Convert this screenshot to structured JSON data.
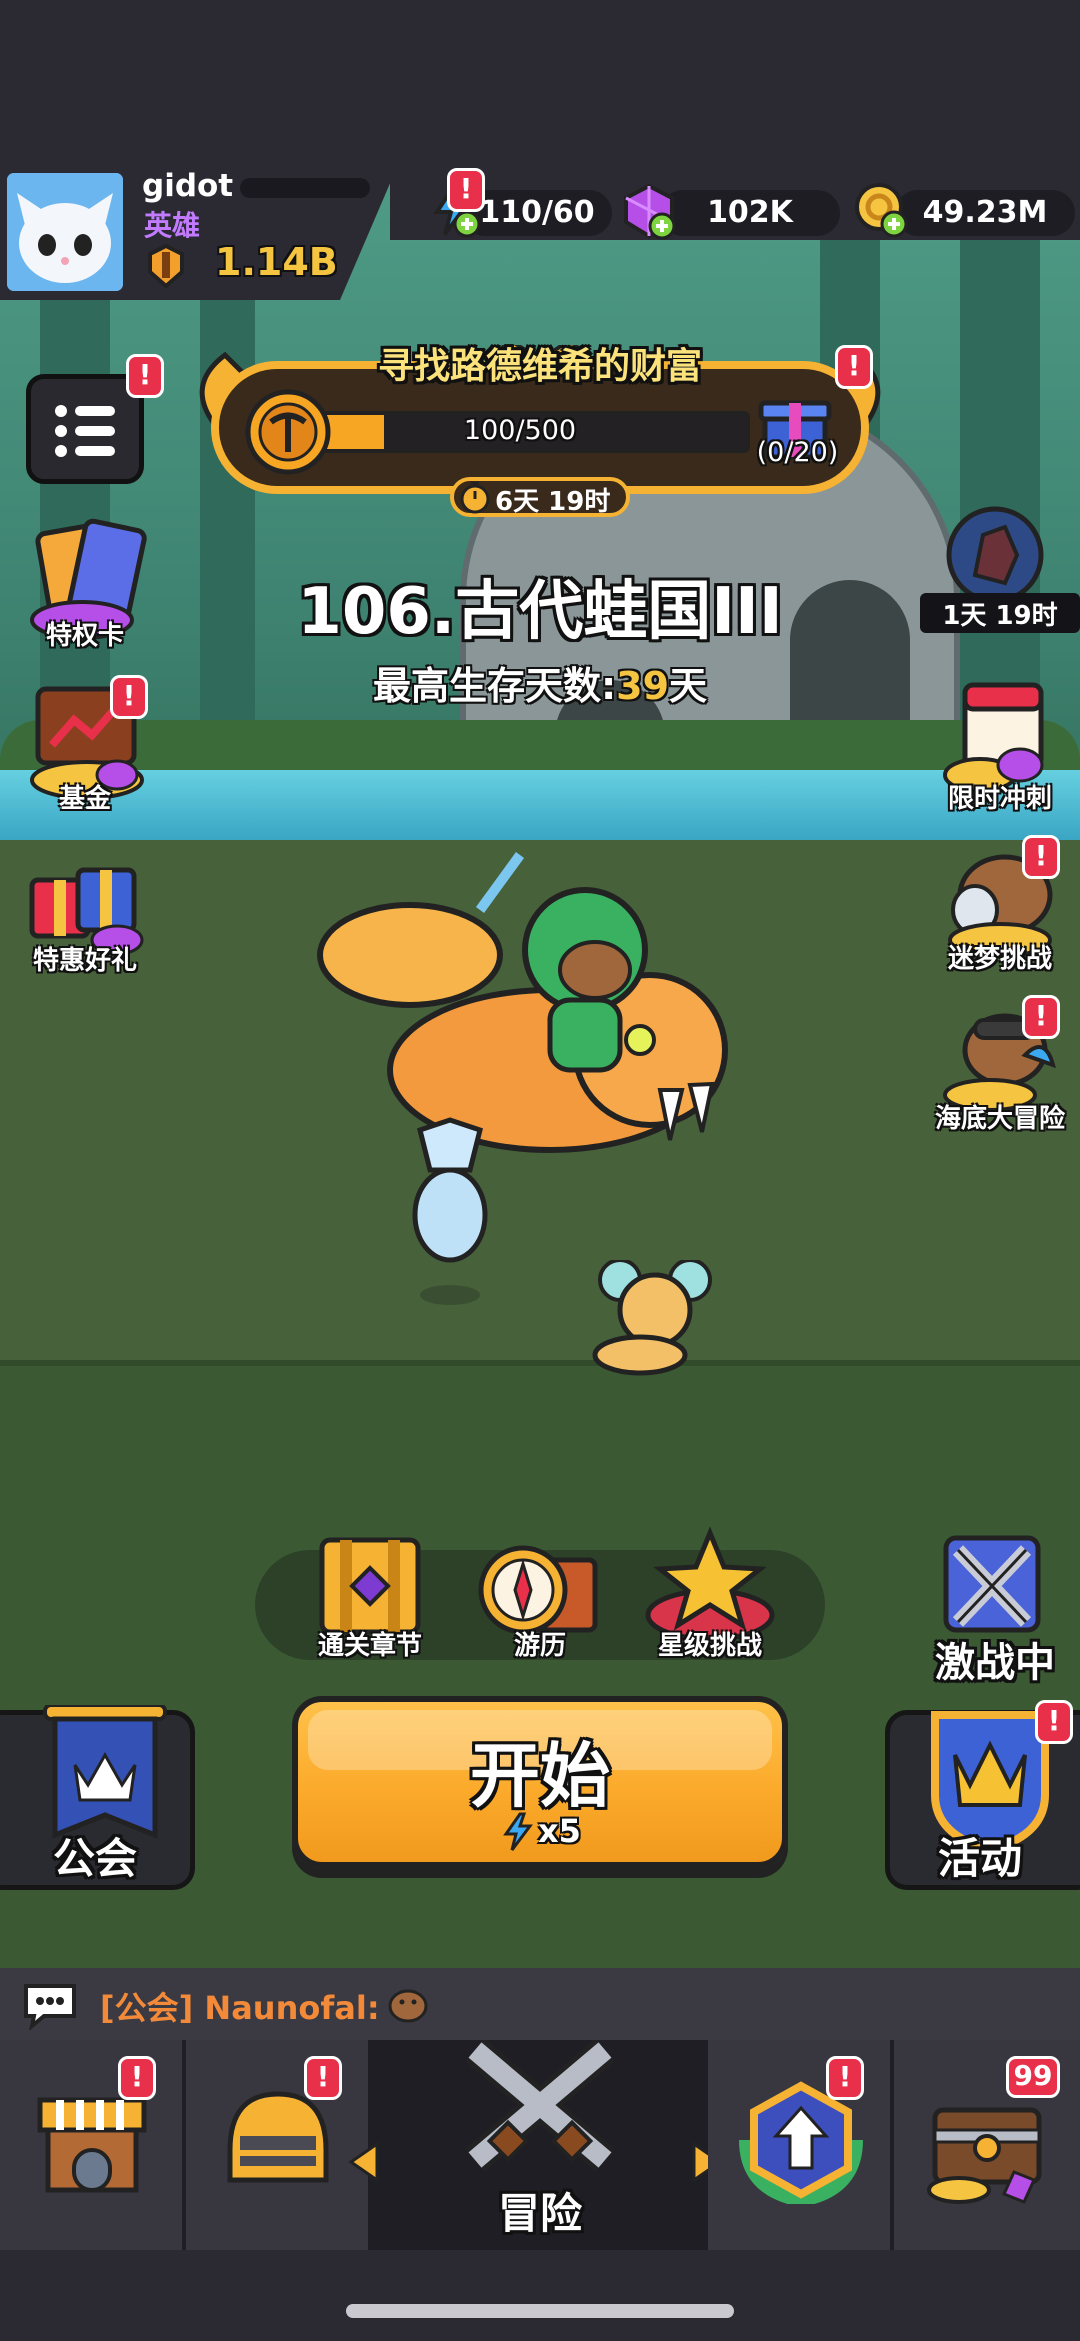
{
  "player": {
    "name": "gidot",
    "rank": "英雄",
    "power": "1.14B"
  },
  "resources": {
    "energy": "110/60",
    "gems": "102K",
    "gold": "49.23M"
  },
  "event": {
    "title": "寻找路德维希的财富",
    "progress_text": "100/500",
    "progress_fraction": 0.2,
    "chest_count": "(0/20)",
    "timer": "6天 19时"
  },
  "stage": {
    "title": "106.古代蛙国III",
    "best_label": "最高生存天数:",
    "best_value": "39",
    "best_unit": "天"
  },
  "left_menu": [
    {
      "label": "特权卡"
    },
    {
      "label": "基金"
    },
    {
      "label": "特惠好礼"
    }
  ],
  "right_menu": [
    {
      "label": "1天 19时"
    },
    {
      "label": "限时冲刺"
    },
    {
      "label": "迷梦挑战"
    },
    {
      "label": "海底大冒险"
    }
  ],
  "actions": [
    {
      "label": "通关章节"
    },
    {
      "label": "游历"
    },
    {
      "label": "星级挑战"
    }
  ],
  "battle_status": "激战中",
  "start": {
    "label": "开始",
    "cost": "x5"
  },
  "guild_label": "公会",
  "events_label": "活动",
  "chat": {
    "channel": "[公会]",
    "sender": "Naunofal:"
  },
  "nav": {
    "center_label": "冒险",
    "chest_count": "99"
  },
  "badge_mark": "!",
  "colors": {
    "accent_orange": "#f6a623",
    "badge_red": "#e8304a",
    "gold_text": "#f5c542",
    "rank_purple": "#c27bff"
  }
}
